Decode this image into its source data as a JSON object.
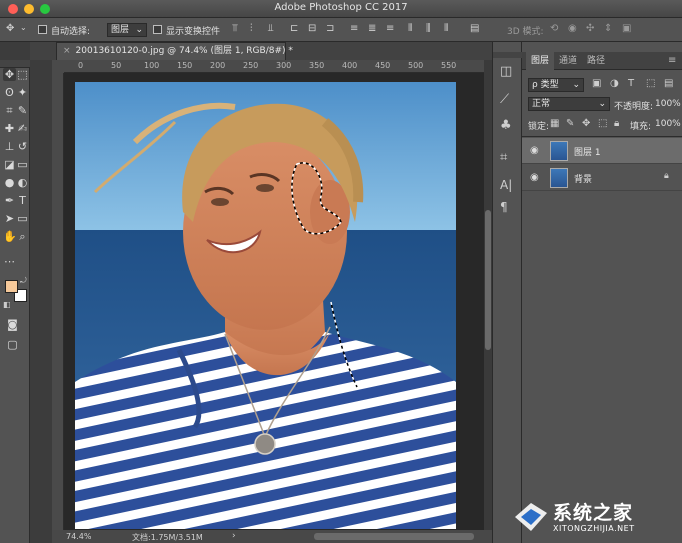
{
  "window": {
    "title": "Adobe Photoshop CC 2017"
  },
  "options_bar": {
    "auto_select_label": "自动选择:",
    "auto_select_value": "图层",
    "show_transform_label": "显示变换控件",
    "mode_3d_label": "3D 模式:"
  },
  "document": {
    "tab_title": "20013610120-0.jpg @ 74.4% (图层 1, RGB/8#) *",
    "ruler_ticks": [
      "0",
      "50",
      "100",
      "150",
      "200",
      "250",
      "300",
      "350",
      "400",
      "450",
      "500",
      "550"
    ]
  },
  "status_bar": {
    "zoom": "74.4%",
    "doc_size": "文档:1.75M/3.51M"
  },
  "layers_panel": {
    "tabs": [
      "图层",
      "通道",
      "路径"
    ],
    "filter_label": "ρ 类型",
    "blend_mode": "正常",
    "opacity_label": "不透明度:",
    "opacity_value": "100%",
    "lock_label": "锁定:",
    "fill_label": "填充:",
    "fill_value": "100%",
    "layers": [
      {
        "name": "图层 1",
        "selected": true
      },
      {
        "name": "背景",
        "locked": true
      }
    ]
  },
  "watermark": {
    "title": "系统之家",
    "subtitle": "XITONGZHIJIA.NET"
  },
  "colors": {
    "foreground": "#f6c99a",
    "background": "#ffffff",
    "panel": "#535353"
  }
}
